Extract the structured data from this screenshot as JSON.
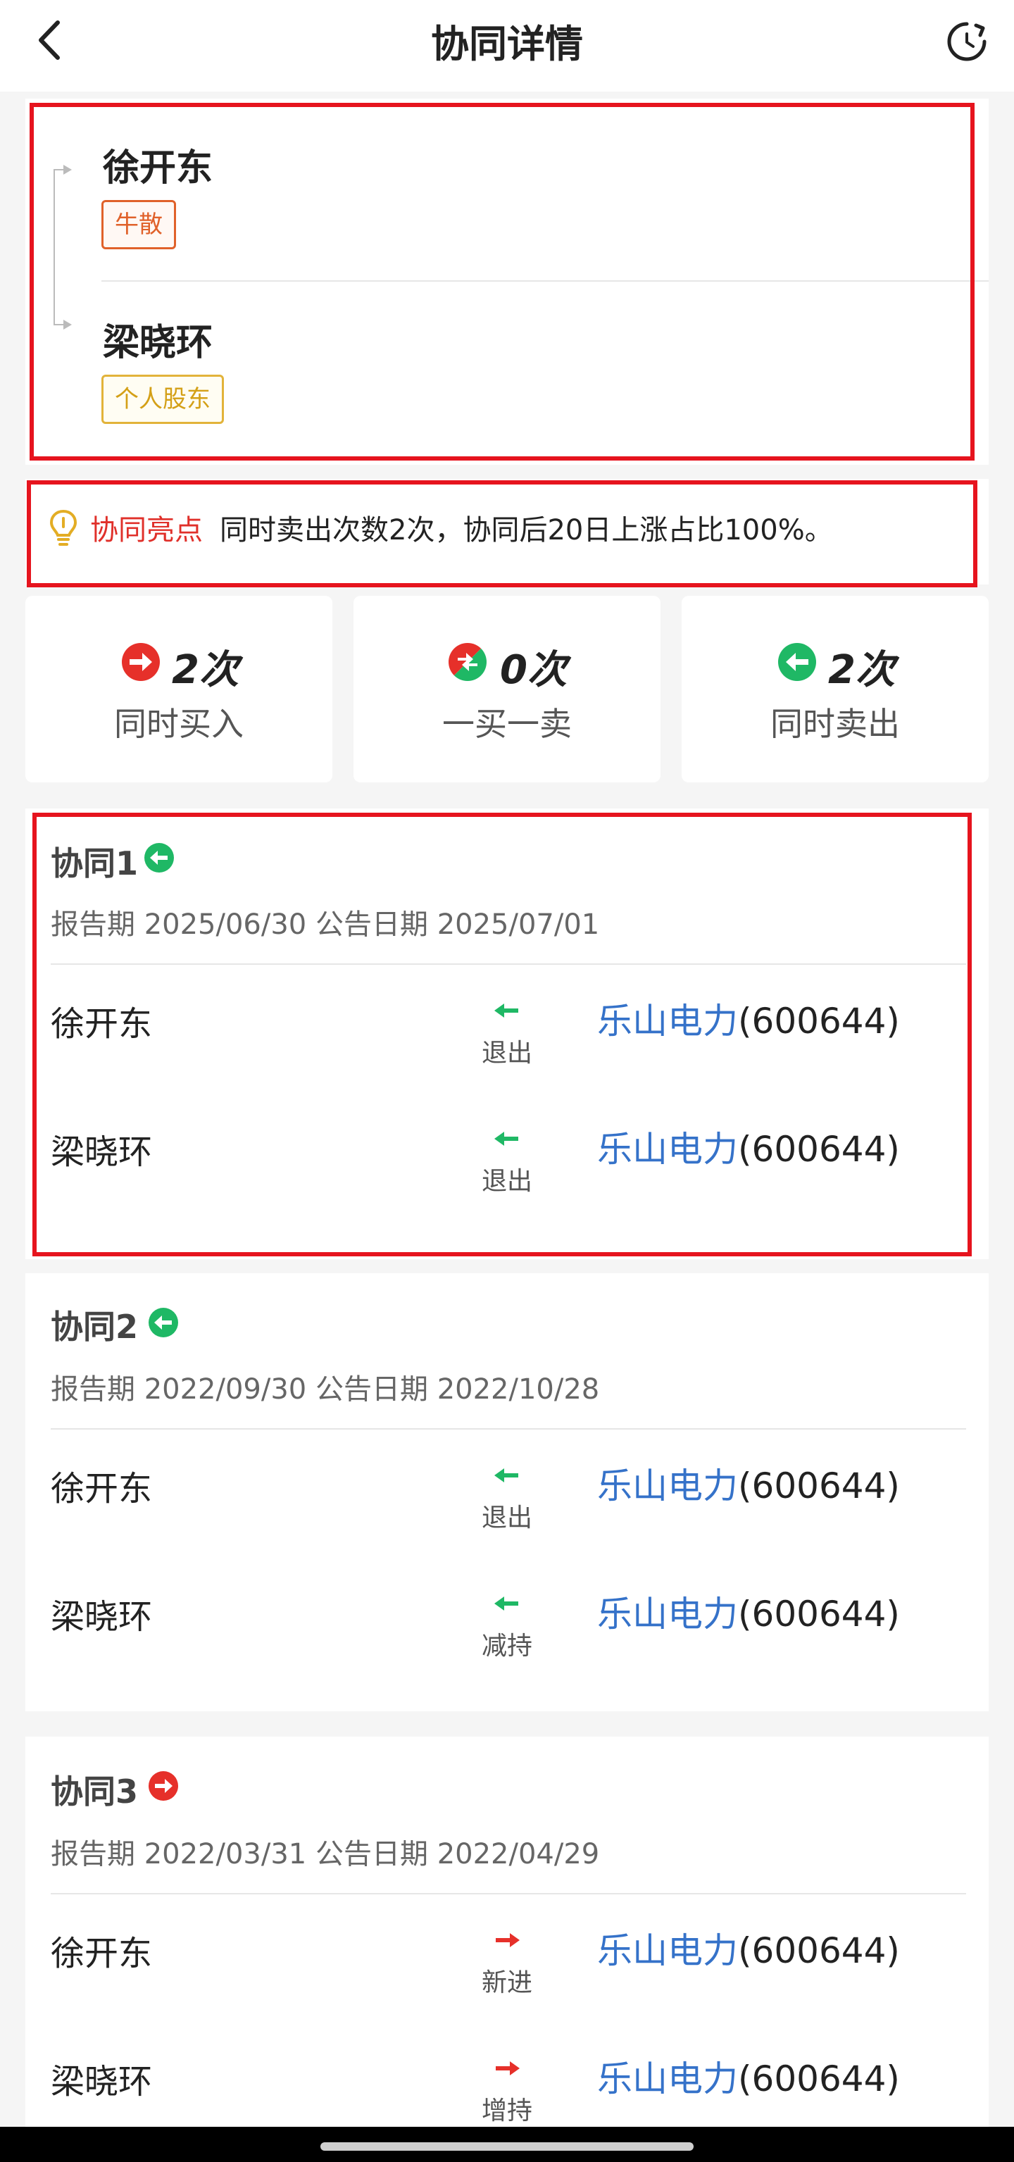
{
  "header": {
    "title": "协同详情",
    "back_icon": "chevron-left-icon",
    "refresh_icon": "refresh-icon"
  },
  "people": [
    {
      "name": "徐开东",
      "tag": "牛散"
    },
    {
      "name": "梁晓环",
      "tag": "个人股东"
    }
  ],
  "highlight": {
    "label": "协同亮点",
    "text": "同时卖出次数2次，协同后20日上涨占比100%。",
    "icon": "lightbulb-icon"
  },
  "stats": [
    {
      "count": "2次",
      "label": "同时买入",
      "icon": "buy-in-icon",
      "color": "#e6302a"
    },
    {
      "count": "0次",
      "label": "一买一卖",
      "icon": "buy-sell-icon",
      "color": "#e6302a"
    },
    {
      "count": "2次",
      "label": "同时卖出",
      "icon": "sell-out-icon",
      "color": "#1fb865"
    }
  ],
  "colors": {
    "red": "#e6302a",
    "green": "#1fb865",
    "link": "#3572c9",
    "orange": "#e0612a",
    "gold": "#d4a017"
  },
  "sections": [
    {
      "title": "协同1",
      "direction": "out",
      "meta": "报告期 2025/06/30  公告日期 2025/07/01",
      "rows": [
        {
          "name": "徐开东",
          "action": "退出",
          "stock_name": "乐山电力",
          "stock_code": "(600644)"
        },
        {
          "name": "梁晓环",
          "action": "退出",
          "stock_name": "乐山电力",
          "stock_code": "(600644)"
        }
      ]
    },
    {
      "title": "协同2",
      "direction": "out",
      "meta": "报告期 2022/09/30  公告日期 2022/10/28",
      "rows": [
        {
          "name": "徐开东",
          "action": "退出",
          "stock_name": "乐山电力",
          "stock_code": "(600644)"
        },
        {
          "name": "梁晓环",
          "action": "减持",
          "stock_name": "乐山电力",
          "stock_code": "(600644)"
        }
      ]
    },
    {
      "title": "协同3",
      "direction": "in",
      "meta": "报告期 2022/03/31  公告日期 2022/04/29",
      "rows": [
        {
          "name": "徐开东",
          "action": "新进",
          "stock_name": "乐山电力",
          "stock_code": "(600644)"
        },
        {
          "name": "梁晓环",
          "action": "增持",
          "stock_name": "乐山电力",
          "stock_code": "(600644)"
        }
      ]
    }
  ]
}
